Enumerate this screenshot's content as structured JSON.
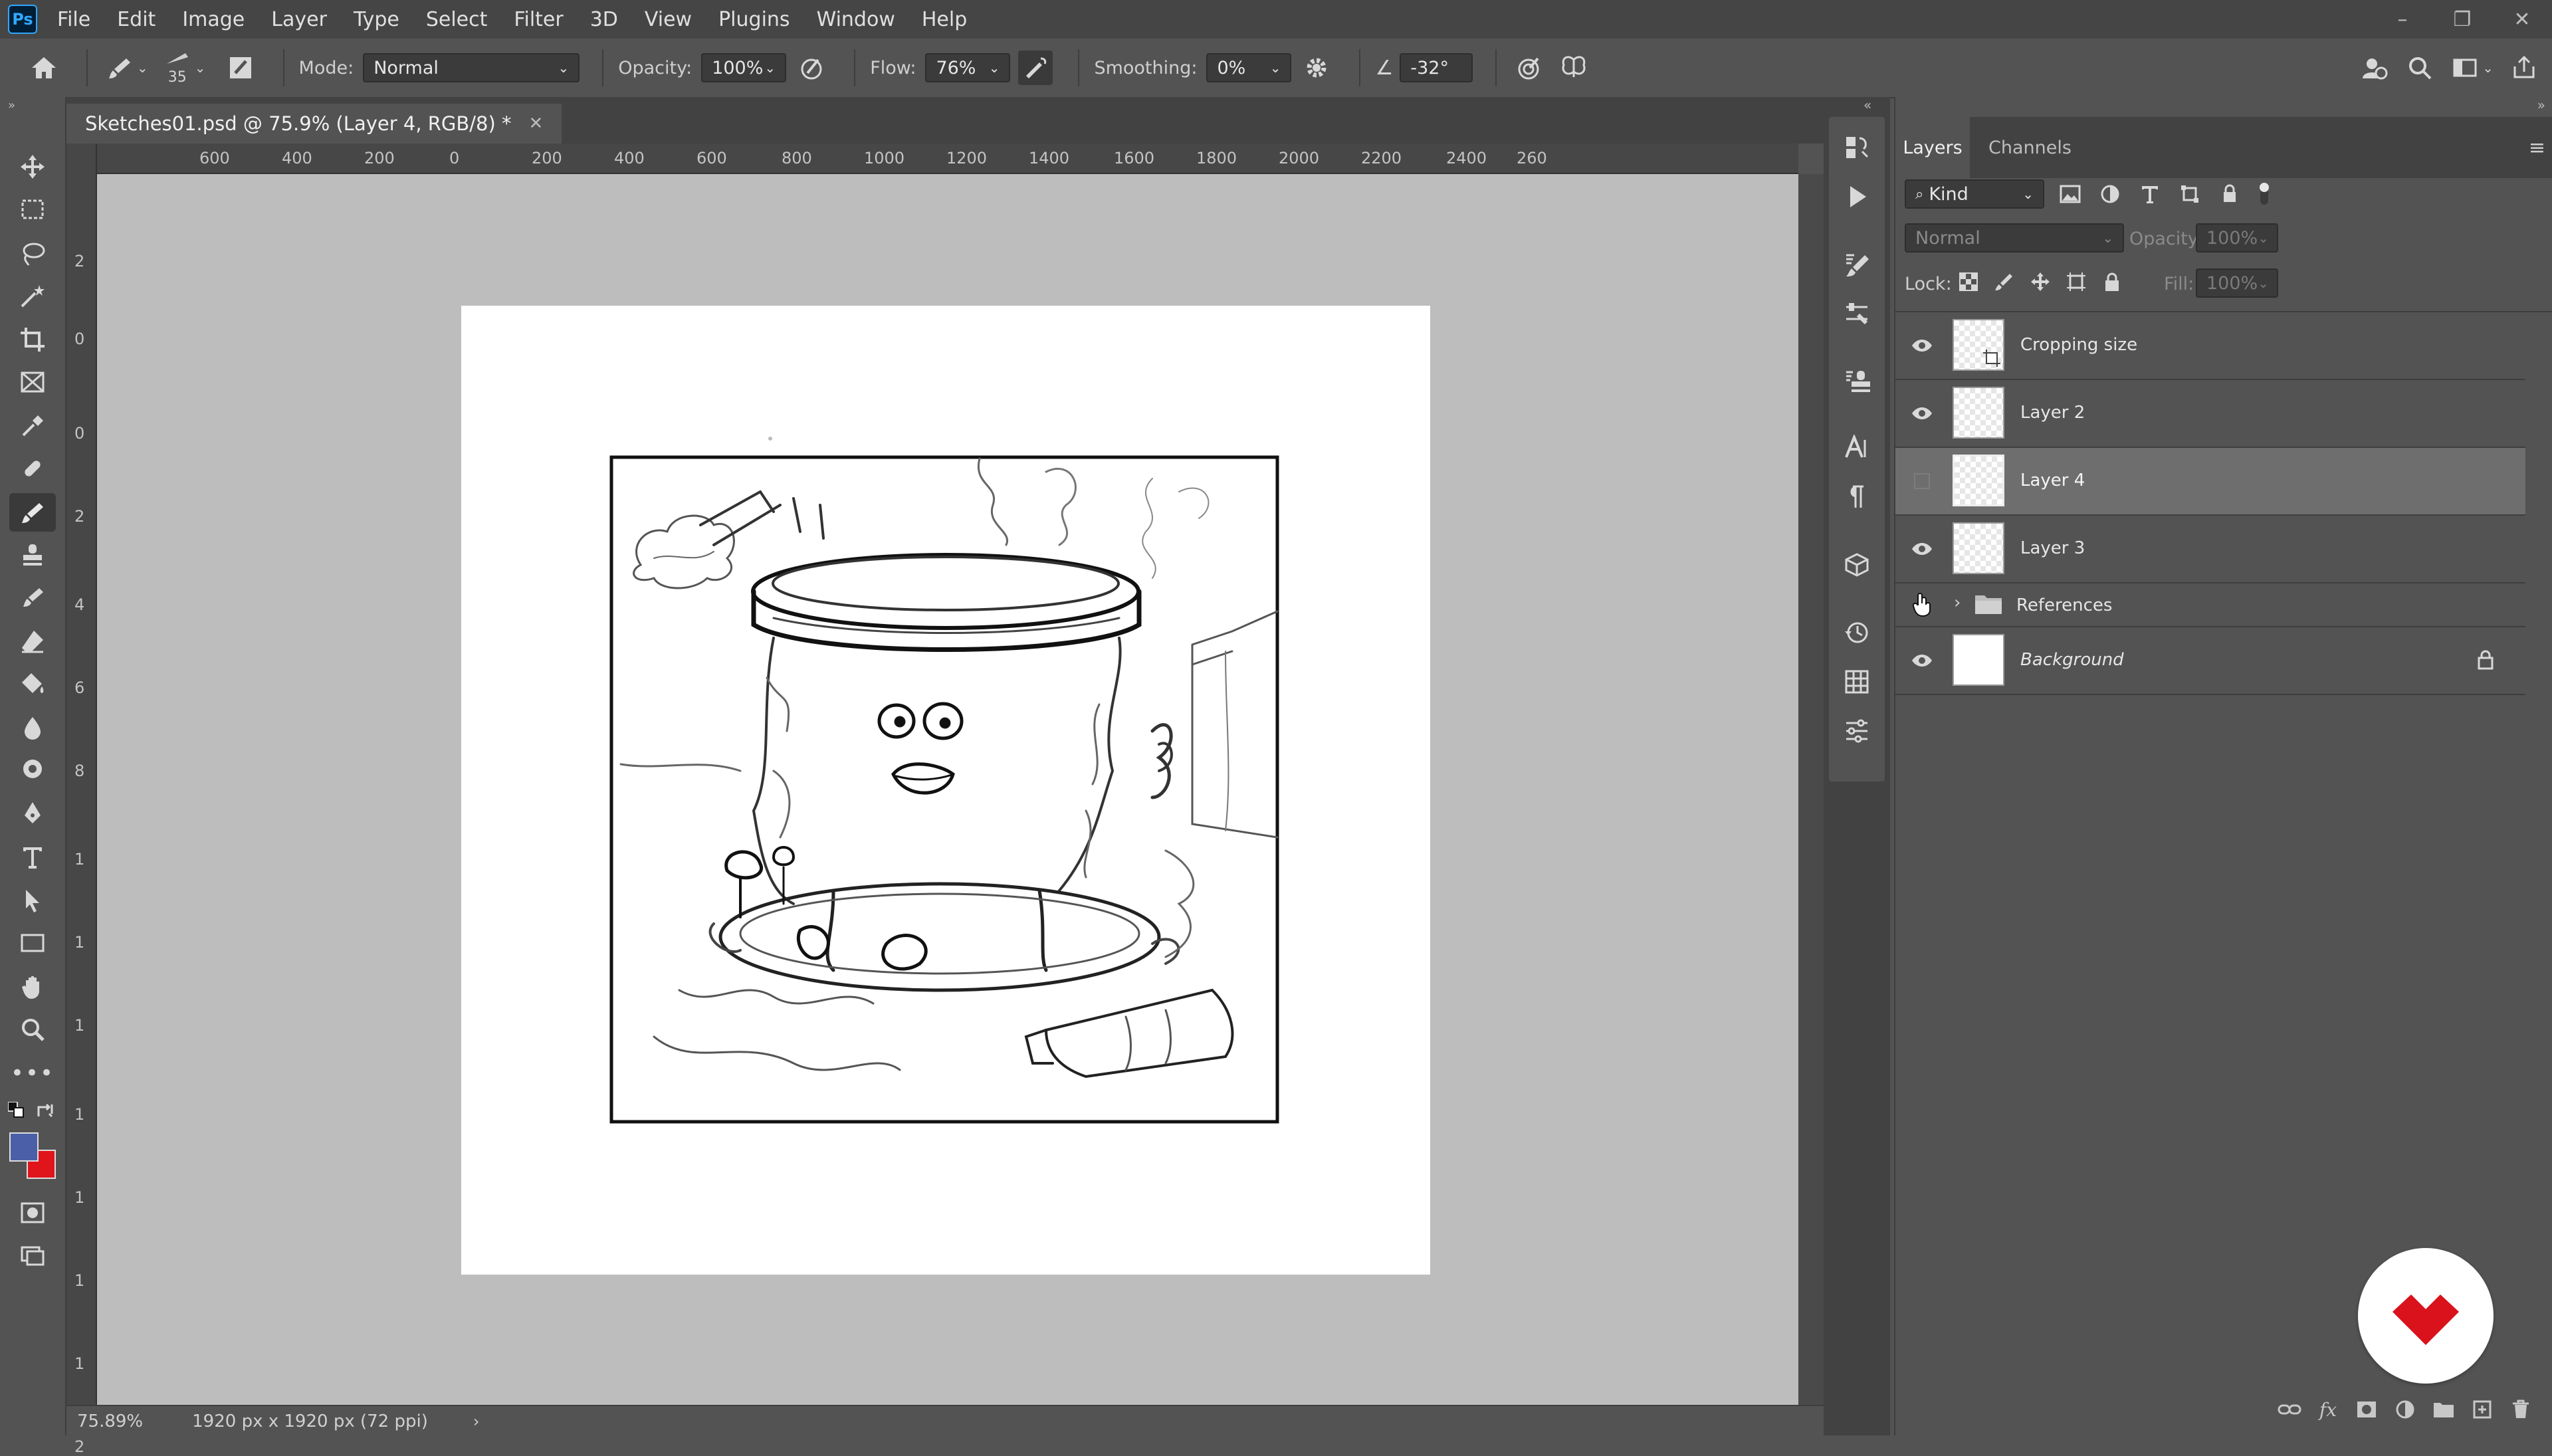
{
  "app": {
    "logo_text": "Ps"
  },
  "menu": [
    "File",
    "Edit",
    "Image",
    "Layer",
    "Type",
    "Select",
    "Filter",
    "3D",
    "View",
    "Plugins",
    "Window",
    "Help"
  ],
  "options_bar": {
    "brush_size": "35",
    "mode_label": "Mode:",
    "mode_value": "Normal",
    "opacity_label": "Opacity:",
    "opacity_value": "100%",
    "flow_label": "Flow:",
    "flow_value": "76%",
    "smoothing_label": "Smoothing:",
    "smoothing_value": "0%",
    "angle_value": "-32°"
  },
  "document": {
    "tab_title": "Sketches01.psd @ 75.9% (Layer 4, RGB/8) *",
    "zoom": "75.89%",
    "dimensions": "1920 px x 1920 px (72 ppi)"
  },
  "ruler_top": [
    "600",
    "400",
    "200",
    "0",
    "200",
    "400",
    "600",
    "800",
    "1000",
    "1200",
    "1400",
    "1600",
    "1800",
    "2000",
    "2200",
    "2400",
    "260"
  ],
  "ruler_left": [
    "2",
    "0",
    "0",
    "2",
    "4",
    "6",
    "8",
    "1",
    "1",
    "1",
    "1",
    "1",
    "1",
    "1",
    "2"
  ],
  "colors": {
    "foreground": "#4a5fa8",
    "background": "#e0141b",
    "accent_logo": "#d9121b"
  },
  "layers_panel": {
    "tabs": [
      "Layers",
      "Channels"
    ],
    "filter_kind": "Kind",
    "blend_mode": "Normal",
    "opacity_label": "Opacity:",
    "opacity_value": "100%",
    "lock_label": "Lock:",
    "fill_label": "Fill:",
    "fill_value": "100%",
    "layers": [
      {
        "name": "Cropping size",
        "visible": true
      },
      {
        "name": "Layer 2",
        "visible": true
      },
      {
        "name": "Layer 4",
        "visible": false,
        "selected": true
      },
      {
        "name": "Layer 3",
        "visible": true
      },
      {
        "name": "References",
        "visible": false,
        "type": "group"
      },
      {
        "name": "Background",
        "visible": true,
        "locked": true
      }
    ]
  }
}
